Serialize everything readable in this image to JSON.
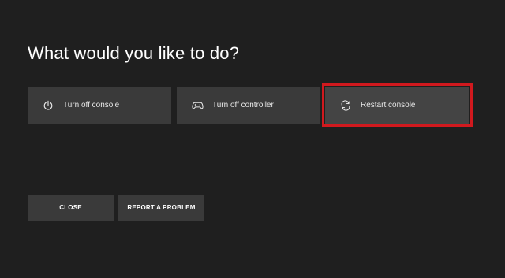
{
  "dialog": {
    "title": "What would you like to do?"
  },
  "options": [
    {
      "label": "Turn off console",
      "icon": "power-icon"
    },
    {
      "label": "Turn off controller",
      "icon": "controller-icon"
    },
    {
      "label": "Restart console",
      "icon": "restart-icon",
      "selected": true
    }
  ],
  "buttons": {
    "close_label": "CLOSE",
    "report_label": "REPORT A PROBLEM"
  },
  "colors": {
    "background": "#1f1f1f",
    "tile": "#3a3a3a",
    "selected_tile": "#444444",
    "highlight_border": "#d1191e",
    "text": "#ffffff"
  }
}
